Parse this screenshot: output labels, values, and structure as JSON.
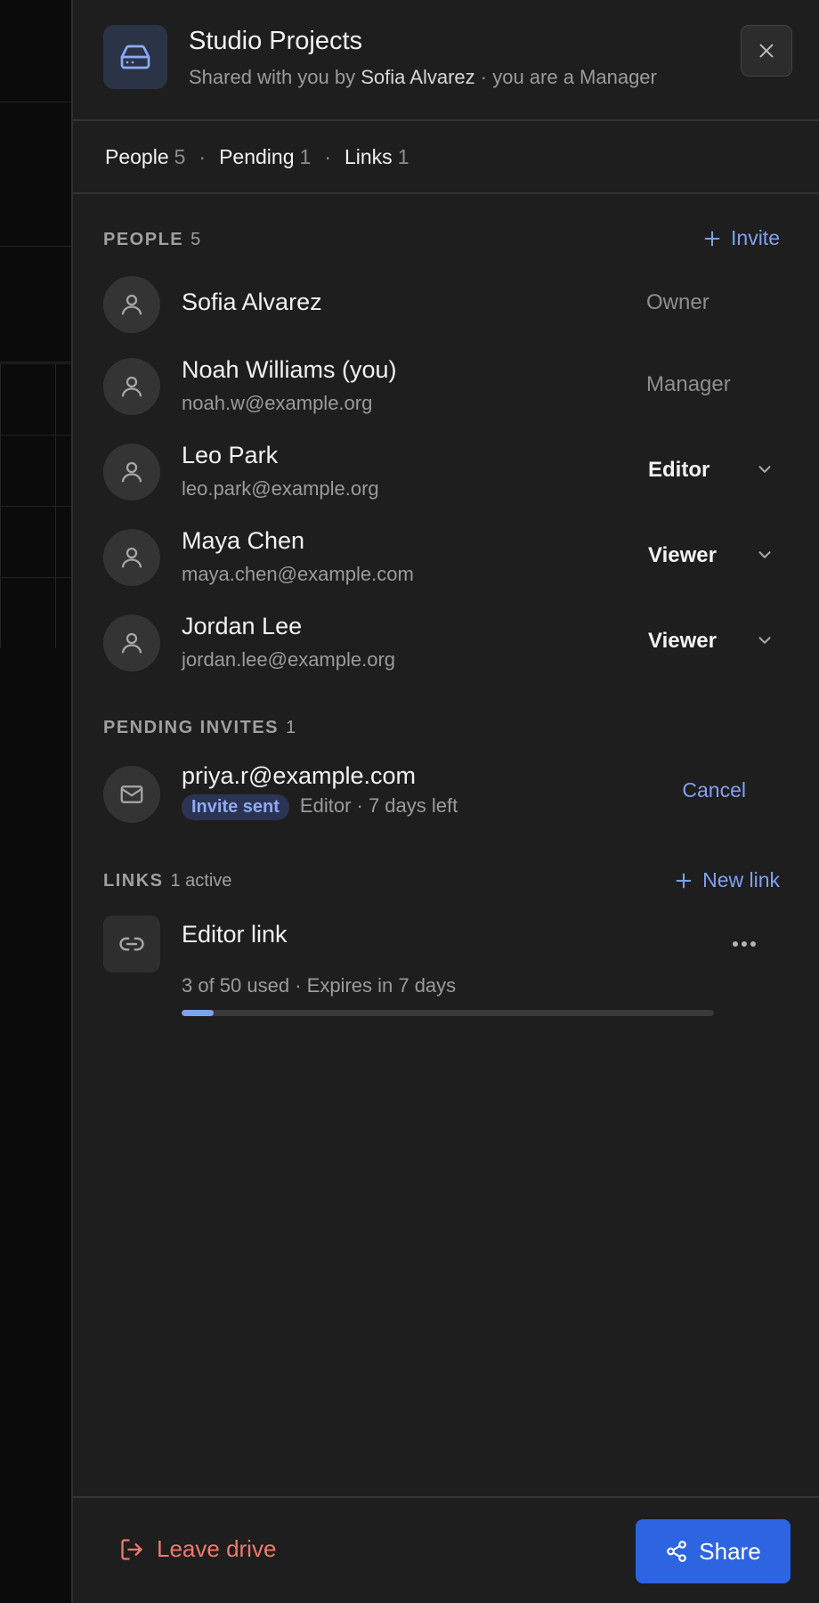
{
  "drive": {
    "title": "Studio Projects",
    "subtitle_prefix": "Shared with you by",
    "owner_name": "Sofia Alvarez",
    "subtitle_suffix": "· you are a Manager"
  },
  "tabs": [
    {
      "label": "People",
      "count": "5"
    },
    {
      "label": "Pending",
      "count": "1"
    },
    {
      "label": "Links",
      "count": "1"
    }
  ],
  "tab_separator": "·",
  "people_section": {
    "label": "PEOPLE",
    "count": "5",
    "action_label": "Invite",
    "members": [
      {
        "name": "Sofia Alvarez",
        "email": "",
        "role": "Owner",
        "editable": false
      },
      {
        "name": "Noah Williams (you)",
        "email": "noah.w@example.org",
        "role": "Manager",
        "editable": false
      },
      {
        "name": "Leo Park",
        "email": "leo.park@example.org",
        "role": "Editor",
        "editable": true
      },
      {
        "name": "Maya Chen",
        "email": "maya.chen@example.com",
        "role": "Viewer",
        "editable": true
      },
      {
        "name": "Jordan Lee",
        "email": "jordan.lee@example.org",
        "role": "Viewer",
        "editable": true
      }
    ]
  },
  "pending_section": {
    "label": "PENDING INVITES",
    "count": "1",
    "invites": [
      {
        "email": "priya.r@example.com",
        "badge": "Invite sent",
        "meta": "Editor · 7 days left",
        "cancel_label": "Cancel"
      }
    ]
  },
  "links_section": {
    "label": "LINKS",
    "status": "1 active",
    "action_label": "New link",
    "links": [
      {
        "name": "Editor link",
        "usage": "3 of 50 used · Expires in 7 days",
        "used": 3,
        "limit": 50
      }
    ]
  },
  "footer": {
    "leave_label": "Leave drive",
    "share_label": "Share"
  },
  "colors": {
    "accent": "#7ea2f2",
    "primary_button": "#2d64e2",
    "danger": "#ee7a6c",
    "panel": "#1e1e1e"
  },
  "icons": {
    "drive": "hard-drive-icon",
    "close": "close-icon",
    "person": "user-icon",
    "mail": "mail-icon",
    "link": "link-icon",
    "more": "more-horizontal-icon",
    "leave": "log-out-icon",
    "share": "share-icon"
  }
}
